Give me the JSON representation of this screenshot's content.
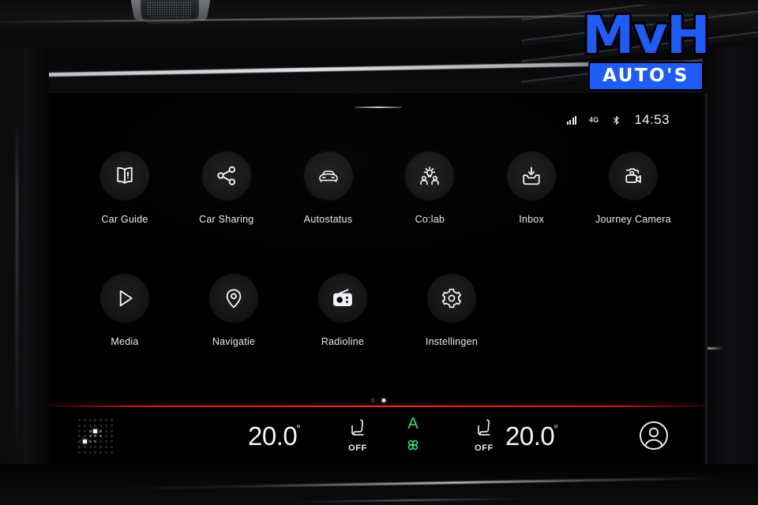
{
  "watermark": {
    "brand": "MvH",
    "subtitle": "AUTO'S",
    "brand_color": "#1f5cf5",
    "outline_color": "#000000"
  },
  "status_bar": {
    "signal_icon": "cellular-signal-icon",
    "network": "4G",
    "bluetooth_icon": "bluetooth-icon",
    "clock": "14:53"
  },
  "apps": {
    "row1": [
      {
        "label": "Car Guide",
        "icon": "book-icon"
      },
      {
        "label": "Car Sharing",
        "icon": "share-nodes-icon"
      },
      {
        "label": "Autostatus",
        "icon": "car-front-icon"
      },
      {
        "label": "Co:lab",
        "icon": "people-lightbulb-icon"
      },
      {
        "label": "Inbox",
        "icon": "inbox-download-icon"
      },
      {
        "label": "Journey Camera",
        "icon": "video-camera-icon"
      }
    ],
    "row2": [
      {
        "label": "Media",
        "icon": "play-triangle-icon"
      },
      {
        "label": "Navigatie",
        "icon": "map-pin-icon"
      },
      {
        "label": "Radioline",
        "icon": "radio-icon"
      },
      {
        "label": "Instellingen",
        "icon": "gear-icon"
      }
    ]
  },
  "pager": {
    "total": 2,
    "active_index": 1
  },
  "divider": {
    "color": "#f02a22"
  },
  "climate": {
    "grid_icon": "dot-matrix-icon",
    "left_temp": {
      "whole": "20.",
      "frac": "0",
      "unit": "°"
    },
    "right_temp": {
      "whole": "20.",
      "frac": "0",
      "unit": "°"
    },
    "left_seat": {
      "icon": "seat-heater-icon",
      "state": "OFF"
    },
    "right_seat": {
      "icon": "seat-heater-icon",
      "state": "OFF"
    },
    "fan": {
      "label": "A",
      "icon": "fan-icon",
      "color": "#2fd66f"
    },
    "profile": {
      "icon": "user-profile-icon"
    }
  }
}
